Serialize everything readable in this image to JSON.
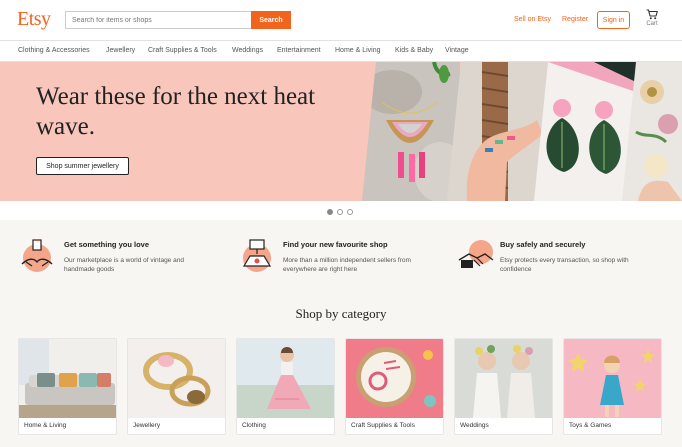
{
  "header": {
    "logo": "Etsy",
    "search_placeholder": "Search for items or shops",
    "search_button": "Search",
    "sell_link": "Sell on Etsy",
    "register_link": "Register",
    "signin_button": "Sign in",
    "cart_label": "Cart"
  },
  "nav": {
    "items": [
      "Clothing & Accessories",
      "Jewellery",
      "Craft Supplies & Tools",
      "Weddings",
      "Entertainment",
      "Home & Living",
      "Kids & Baby",
      "Vintage"
    ]
  },
  "hero": {
    "title": "Wear these for the next heat wave.",
    "cta": "Shop summer jewellery",
    "background_color": "#f8c6bb",
    "carousel_active_index": 0,
    "carousel_count": 3
  },
  "props": [
    {
      "title": "Get something you love",
      "text": "Our marketplace is a world of vintage and handmade goods",
      "icon": "gift-hands-icon"
    },
    {
      "title": "Find your new favourite shop",
      "text": "More than a million independent sellers from everywhere are right here",
      "icon": "shop-sign-icon"
    },
    {
      "title": "Buy safely and securely",
      "text": "Etsy protects every transaction, so shop with confidence",
      "icon": "handshake-icon"
    }
  ],
  "categories": {
    "heading": "Shop by category",
    "items": [
      {
        "label": "Home & Living"
      },
      {
        "label": "Jewellery"
      },
      {
        "label": "Clothing"
      },
      {
        "label": "Craft Supplies & Tools"
      },
      {
        "label": "Weddings"
      },
      {
        "label": "Toys & Games"
      }
    ]
  },
  "colors": {
    "brand": "#f1641e",
    "page_bg": "#f7f6f3"
  }
}
